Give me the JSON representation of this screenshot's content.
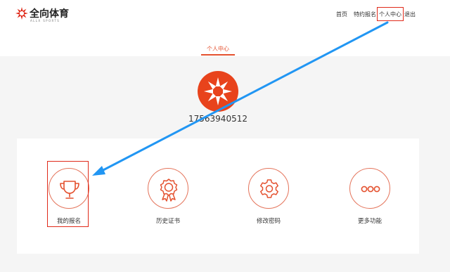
{
  "header": {
    "logo_text": "全向体育",
    "logo_sub": "ALLX SPORTS",
    "nav": {
      "home": "首页",
      "special_signup": "特约报名",
      "personal_center": "个人中心",
      "logout": "退出"
    }
  },
  "tabs": {
    "active": "个人中心"
  },
  "profile": {
    "username": "17563940512"
  },
  "features": [
    {
      "label": "我的报名",
      "icon": "trophy-icon"
    },
    {
      "label": "历史证书",
      "icon": "badge-icon"
    },
    {
      "label": "修改密码",
      "icon": "gear-icon"
    },
    {
      "label": "更多功能",
      "icon": "more-icon"
    }
  ],
  "colors": {
    "accent": "#e4512f",
    "highlight": "#e02a1a",
    "annotation_arrow": "#2196f3"
  }
}
